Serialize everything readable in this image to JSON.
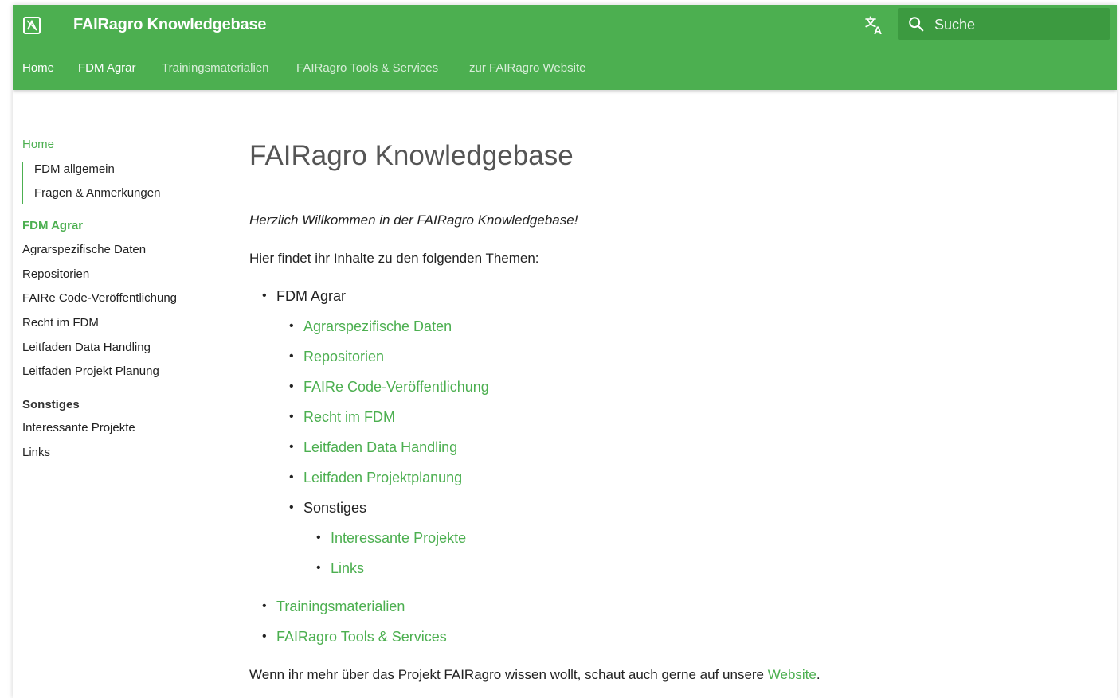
{
  "header": {
    "title": "FAIRagro Knowledgebase",
    "logo_icon": "book-logo-icon",
    "language_icon": "translate-icon",
    "search": {
      "placeholder": "Suche",
      "value": "",
      "icon": "search-icon"
    },
    "brand_color": "#4caf50"
  },
  "tabs": [
    {
      "label": "Home",
      "state": "active"
    },
    {
      "label": "FDM Agrar",
      "state": "bold"
    },
    {
      "label": "Trainingsmaterialien",
      "state": "normal"
    },
    {
      "label": "FAIRagro Tools & Services",
      "state": "normal"
    },
    {
      "label": "zur FAIRagro Website",
      "state": "normal"
    }
  ],
  "sidebar": {
    "home": "Home",
    "home_children": [
      "FDM allgemein",
      "Fragen & Anmerkungen"
    ],
    "section_fdm": "FDM Agrar",
    "fdm_items": [
      "Agrarspezifische Daten",
      "Repositorien",
      "FAIRe Code-Veröffentlichung",
      "Recht im FDM",
      "Leitfaden Data Handling",
      "Leitfaden Projekt Planung"
    ],
    "section_other": "Sonstiges",
    "other_items": [
      "Interessante Projekte",
      "Links"
    ]
  },
  "main": {
    "title": "FAIRagro Knowledgebase",
    "intro": "Herzlich Willkommen in der FAIRagro Knowledgebase!",
    "topics_intro": "Hier findet ihr Inhalte zu den folgenden Themen:",
    "list": {
      "fdm_agrar": "FDM Agrar",
      "fdm_links": [
        "Agrarspezifische Daten",
        "Repositorien",
        "FAIRe Code-Veröffentlichung",
        "Recht im FDM",
        "Leitfaden Data Handling",
        "Leitfaden Projektplanung"
      ],
      "sonstiges": "Sonstiges",
      "sonstiges_links": [
        "Interessante Projekte",
        "Links"
      ],
      "top_links": [
        "Trainingsmaterialien",
        "FAIRagro Tools & Services"
      ]
    },
    "footer_text": "Wenn ihr mehr über das Projekt FAIRagro wissen wollt, schaut auch gerne auf unsere ",
    "footer_link": "Website",
    "footer_end": "."
  }
}
